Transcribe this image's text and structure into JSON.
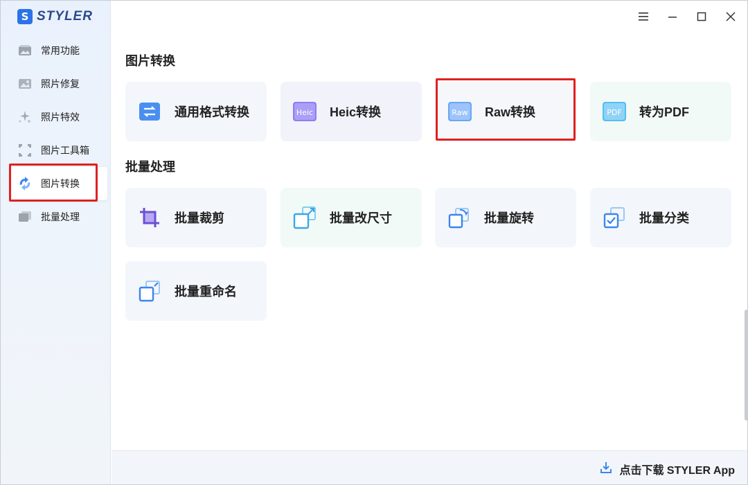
{
  "app": {
    "logo_letter": "S",
    "name": "STYLER"
  },
  "sidebar": {
    "items": [
      {
        "label": "常用功能",
        "icon": "image-stack-icon"
      },
      {
        "label": "照片修复",
        "icon": "image-repair-icon"
      },
      {
        "label": "照片特效",
        "icon": "sparkle-effects-icon"
      },
      {
        "label": "图片工具箱",
        "icon": "crop-frame-icon"
      },
      {
        "label": "图片转换",
        "icon": "convert-arrows-icon",
        "active": true
      },
      {
        "label": "批量处理",
        "icon": "batch-stack-icon"
      }
    ]
  },
  "window_controls": {
    "menu": "menu-icon",
    "minimize": "minimize-icon",
    "maximize": "maximize-icon",
    "close": "close-icon"
  },
  "sections": {
    "convert": {
      "title": "图片转换",
      "cards": [
        {
          "label": "通用格式转换",
          "icon": "format-convert-icon"
        },
        {
          "label": "Heic转换",
          "icon": "heic-icon",
          "badge": "Heic"
        },
        {
          "label": "Raw转换",
          "icon": "raw-icon",
          "badge": "Raw"
        },
        {
          "label": "转为PDF",
          "icon": "pdf-icon",
          "badge": "PDF"
        }
      ]
    },
    "batch": {
      "title": "批量处理",
      "cards": [
        {
          "label": "批量裁剪",
          "icon": "crop-icon"
        },
        {
          "label": "批量改尺寸",
          "icon": "resize-icon"
        },
        {
          "label": "批量旋转",
          "icon": "rotate-icon"
        },
        {
          "label": "批量分类",
          "icon": "classify-icon"
        },
        {
          "label": "批量重命名",
          "icon": "rename-icon"
        }
      ]
    }
  },
  "footer": {
    "download_label": "点击下载 STYLER App"
  },
  "colors": {
    "accent": "#2a73e8",
    "highlight": "#e02020",
    "sidebar_bg": "#eaf1fc"
  }
}
